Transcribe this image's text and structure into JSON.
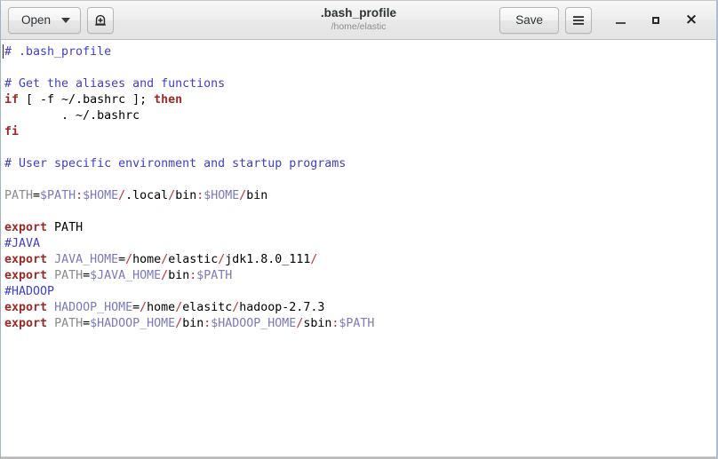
{
  "window": {
    "title": ".bash_profile",
    "subtitle": "/home/elastic"
  },
  "toolbar": {
    "open_label": "Open",
    "open_caret_icon": "chevron-down-icon",
    "new_document_icon": "new-document-icon",
    "save_label": "Save",
    "menu_icon": "hamburger-menu-icon"
  },
  "window_controls": {
    "minimize_icon": "minimize-icon",
    "maximize_icon": "maximize-icon",
    "close_icon": "close-icon",
    "close_glyph": "×"
  },
  "colors": {
    "comment": "#4040c0",
    "keyword": "#9a2a2a",
    "variable": "#7a7aba",
    "separator": "#c03030",
    "assignee": "#8a8a8a",
    "plain": "#000000",
    "editor_background": "#ffffff",
    "headerbar_background": "#ededed",
    "title_subtitle": "#8d8d8d"
  },
  "editor": {
    "filename": ".bash_profile",
    "language": "sh",
    "cursor_line": 1,
    "cursor_column": 1,
    "lines": [
      {
        "n": 1,
        "tokens": [
          {
            "t": "# .bash_profile",
            "c": "comment"
          }
        ]
      },
      {
        "n": 2,
        "tokens": []
      },
      {
        "n": 3,
        "tokens": [
          {
            "t": "# Get the aliases and functions",
            "c": "comment"
          }
        ]
      },
      {
        "n": 4,
        "tokens": [
          {
            "t": "if",
            "c": "keyword"
          },
          {
            "t": " [ -f ~/.bashrc ]; ",
            "c": "plain"
          },
          {
            "t": "then",
            "c": "keyword"
          }
        ]
      },
      {
        "n": 5,
        "tokens": [
          {
            "t": "        . ~/.bashrc",
            "c": "plain"
          }
        ]
      },
      {
        "n": 6,
        "tokens": [
          {
            "t": "fi",
            "c": "keyword"
          }
        ]
      },
      {
        "n": 7,
        "tokens": []
      },
      {
        "n": 8,
        "tokens": [
          {
            "t": "# User specific environment and startup programs",
            "c": "comment"
          }
        ]
      },
      {
        "n": 9,
        "tokens": []
      },
      {
        "n": 10,
        "tokens": [
          {
            "t": "PATH",
            "c": "assignee"
          },
          {
            "t": "=",
            "c": "op"
          },
          {
            "t": "$PATH",
            "c": "variable"
          },
          {
            "t": ":",
            "c": "separator"
          },
          {
            "t": "$HOME",
            "c": "variable"
          },
          {
            "t": "/",
            "c": "separator"
          },
          {
            "t": ".local",
            "c": "plain"
          },
          {
            "t": "/",
            "c": "separator"
          },
          {
            "t": "bin",
            "c": "plain"
          },
          {
            "t": ":",
            "c": "separator"
          },
          {
            "t": "$HOME",
            "c": "variable"
          },
          {
            "t": "/",
            "c": "separator"
          },
          {
            "t": "bin",
            "c": "plain"
          }
        ]
      },
      {
        "n": 11,
        "tokens": []
      },
      {
        "n": 12,
        "tokens": [
          {
            "t": "export",
            "c": "keyword"
          },
          {
            "t": " PATH",
            "c": "plain"
          }
        ]
      },
      {
        "n": 13,
        "tokens": [
          {
            "t": "#JAVA",
            "c": "comment"
          }
        ]
      },
      {
        "n": 14,
        "tokens": [
          {
            "t": "export",
            "c": "keyword"
          },
          {
            "t": " ",
            "c": "plain"
          },
          {
            "t": "JAVA_HOME",
            "c": "variable"
          },
          {
            "t": "=",
            "c": "op"
          },
          {
            "t": "/",
            "c": "separator"
          },
          {
            "t": "home",
            "c": "plain"
          },
          {
            "t": "/",
            "c": "separator"
          },
          {
            "t": "elastic",
            "c": "plain"
          },
          {
            "t": "/",
            "c": "separator"
          },
          {
            "t": "jdk1.8.0_111",
            "c": "plain"
          },
          {
            "t": "/",
            "c": "separator"
          }
        ]
      },
      {
        "n": 15,
        "tokens": [
          {
            "t": "export",
            "c": "keyword"
          },
          {
            "t": " ",
            "c": "plain"
          },
          {
            "t": "PATH",
            "c": "assignee"
          },
          {
            "t": "=",
            "c": "op"
          },
          {
            "t": "$JAVA_HOME",
            "c": "variable"
          },
          {
            "t": "/",
            "c": "separator"
          },
          {
            "t": "bin",
            "c": "plain"
          },
          {
            "t": ":",
            "c": "separator"
          },
          {
            "t": "$PATH",
            "c": "variable"
          }
        ]
      },
      {
        "n": 16,
        "tokens": [
          {
            "t": "#HADOOP",
            "c": "comment"
          }
        ]
      },
      {
        "n": 17,
        "tokens": [
          {
            "t": "export",
            "c": "keyword"
          },
          {
            "t": " ",
            "c": "plain"
          },
          {
            "t": "HADOOP_HOME",
            "c": "variable"
          },
          {
            "t": "=",
            "c": "op"
          },
          {
            "t": "/",
            "c": "separator"
          },
          {
            "t": "home",
            "c": "plain"
          },
          {
            "t": "/",
            "c": "separator"
          },
          {
            "t": "elasitc",
            "c": "plain"
          },
          {
            "t": "/",
            "c": "separator"
          },
          {
            "t": "hadoop-2.7.3",
            "c": "plain"
          }
        ]
      },
      {
        "n": 18,
        "tokens": [
          {
            "t": "export",
            "c": "keyword"
          },
          {
            "t": " ",
            "c": "plain"
          },
          {
            "t": "PATH",
            "c": "assignee"
          },
          {
            "t": "=",
            "c": "op"
          },
          {
            "t": "$HADOOP_HOME",
            "c": "variable"
          },
          {
            "t": "/",
            "c": "separator"
          },
          {
            "t": "bin",
            "c": "plain"
          },
          {
            "t": ":",
            "c": "separator"
          },
          {
            "t": "$HADOOP_HOME",
            "c": "variable"
          },
          {
            "t": "/",
            "c": "separator"
          },
          {
            "t": "sbin",
            "c": "plain"
          },
          {
            "t": ":",
            "c": "separator"
          },
          {
            "t": "$PATH",
            "c": "variable"
          }
        ]
      }
    ]
  }
}
